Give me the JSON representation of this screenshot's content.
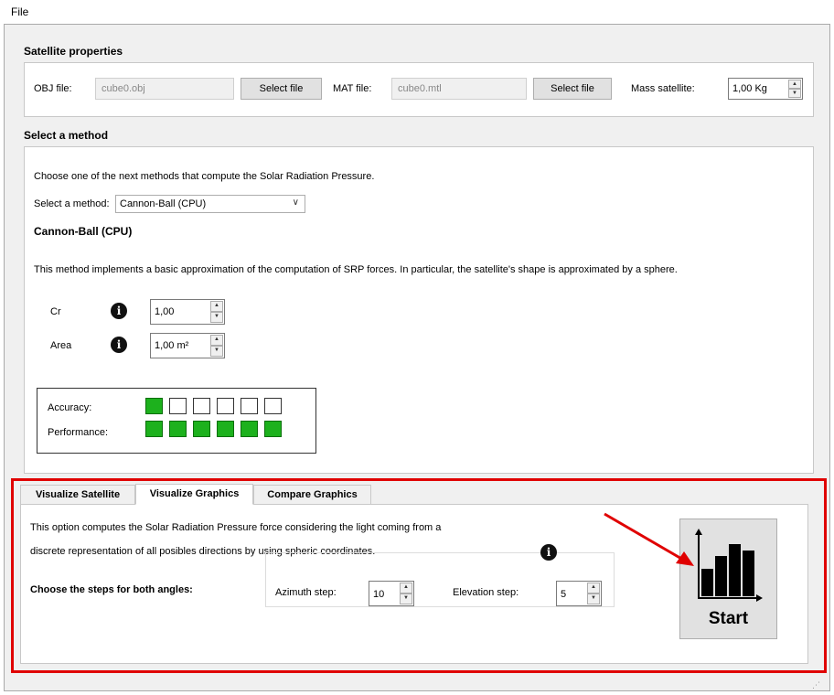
{
  "menu": {
    "file": "File"
  },
  "satellite_properties": {
    "title": "Satellite properties",
    "obj_label": "OBJ file:",
    "obj_value": "cube0.obj",
    "obj_button": "Select file",
    "mat_label": "MAT file:",
    "mat_value": "cube0.mtl",
    "mat_button": "Select file",
    "mass_label": "Mass satellite:",
    "mass_value": "1,00 Kg"
  },
  "method": {
    "title": "Select a method",
    "intro": "Choose one of the next methods that compute the Solar Radiation Pressure.",
    "select_label": "Select a method:",
    "selected": "Cannon-Ball (CPU)",
    "heading": "Cannon-Ball (CPU)",
    "description": "This method implements a basic approximation of the computation of SRP forces. In particular, the satellite's shape is approximated by a sphere.",
    "cr_label": "Cr",
    "cr_value": "1,00",
    "area_label": "Area",
    "area_value": "1,00 m²",
    "accuracy_label": "Accuracy:",
    "accuracy_level": 1,
    "performance_label": "Performance:",
    "performance_level": 6,
    "scale_max": 6
  },
  "tabs": [
    {
      "label": "Visualize Satellite"
    },
    {
      "label": "Visualize Graphics"
    },
    {
      "label": "Compare Graphics"
    }
  ],
  "visualize_graphics": {
    "line1": "This option computes the Solar Radiation Pressure force considering the light coming from a",
    "line2": "discrete representation of all posibles directions by using spheric coordinates.",
    "steps_label": "Choose the steps for both angles:",
    "azimuth_label": "Azimuth step:",
    "azimuth_value": "10",
    "elevation_label": "Elevation step:",
    "elevation_value": "5",
    "start_label": "Start"
  },
  "colors": {
    "accent_highlight": "#e00000",
    "level_on": "#1db11d"
  },
  "icons": {
    "info": "info-icon",
    "chart": "bar-chart-icon"
  }
}
